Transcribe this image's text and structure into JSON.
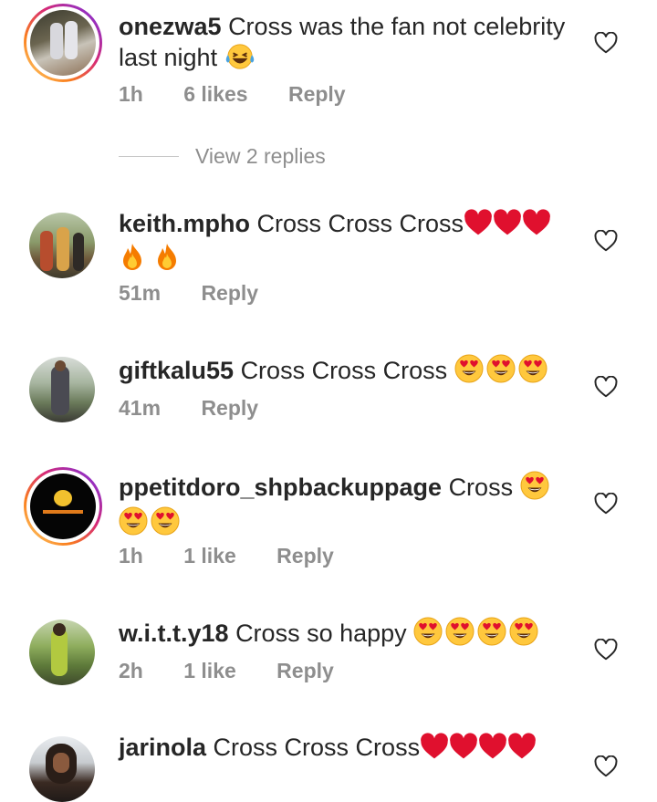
{
  "comments": [
    {
      "username": "onezwa5",
      "text": "Cross was the fan not celebrity  last night",
      "emojis": [
        "laugh-cry"
      ],
      "time": "1h",
      "likes": "6 likes",
      "reply": "Reply",
      "view_replies": "View 2 replies"
    },
    {
      "username": "keith.mpho",
      "text": "Cross Cross Cross",
      "emojis": [
        "heart",
        "heart",
        "heart",
        "fire",
        "fire"
      ],
      "time": "51m",
      "reply": "Reply"
    },
    {
      "username": "giftkalu55",
      "text": "Cross Cross Cross",
      "emojis": [
        "heart-eyes",
        "heart-eyes",
        "heart-eyes"
      ],
      "time": "41m",
      "reply": "Reply"
    },
    {
      "username": "ppetitdoro_shpbackuppage",
      "text": "Cross",
      "emojis": [
        "heart-eyes",
        "heart-eyes",
        "heart-eyes"
      ],
      "time": "1h",
      "likes": "1 like",
      "reply": "Reply"
    },
    {
      "username": "w.i.t.t.y18",
      "text": "Cross so happy",
      "emojis": [
        "heart-eyes",
        "heart-eyes",
        "heart-eyes",
        "heart-eyes"
      ],
      "time": "2h",
      "likes": "1 like",
      "reply": "Reply"
    },
    {
      "username": "jarinola",
      "text": "Cross Cross Cross",
      "emojis": [
        "heart",
        "heart",
        "heart",
        "heart"
      ]
    }
  ],
  "colors": {
    "text": "#262626",
    "meta": "#8e8e8e",
    "heart_red": "#e0102e"
  }
}
